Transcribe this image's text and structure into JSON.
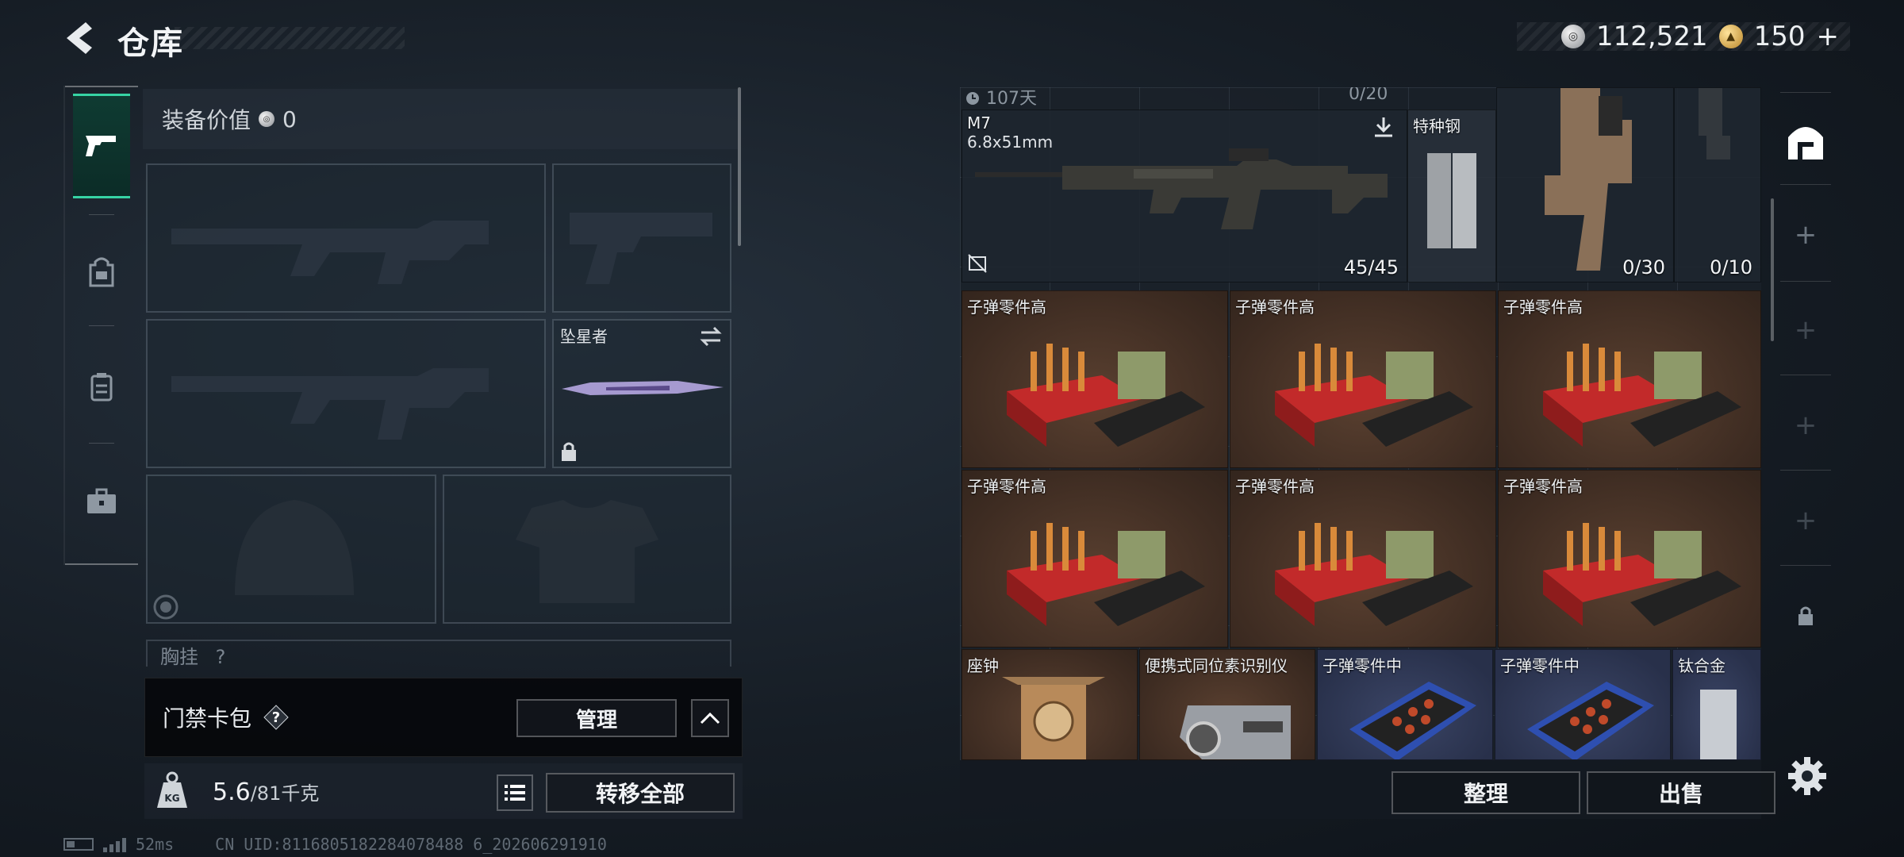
{
  "header": {
    "title": "仓库",
    "currency_silver": "112,521",
    "currency_gold": "150",
    "currency_gold_add": "+"
  },
  "side_nav": {
    "items": [
      "weapon",
      "backpack",
      "vest",
      "case"
    ]
  },
  "equipment": {
    "value_label": "装备价值",
    "value": "0",
    "melee_name": "坠星者",
    "chest_label": "胸挂",
    "chest_help": "?"
  },
  "keycard": {
    "label": "门禁卡包",
    "help": "?",
    "manage": "管理"
  },
  "weight": {
    "current": "5.6",
    "max": "/81千克",
    "transfer": "转移全部"
  },
  "footer": {
    "ping": "52ms",
    "uid": "CN UID:8116805182284078488 6_202606291910"
  },
  "storage": {
    "top_left_faded": "107天",
    "top_right_faded": "0/20",
    "items": [
      {
        "name": "M7",
        "sub": "6.8x51mm",
        "count": "45/45"
      },
      {
        "name": "特种钢",
        "count": ""
      },
      {
        "name": "",
        "count": "0/30"
      },
      {
        "name": "",
        "count": "0/10"
      },
      {
        "name": "子弹零件高"
      },
      {
        "name": "子弹零件高"
      },
      {
        "name": "子弹零件高"
      },
      {
        "name": "子弹零件高"
      },
      {
        "name": "子弹零件高"
      },
      {
        "name": "子弹零件高"
      },
      {
        "name": "座钟"
      },
      {
        "name": "便携式同位素识别仪"
      },
      {
        "name": "子弹零件中"
      },
      {
        "name": "子弹零件中"
      },
      {
        "name": "钛合金"
      }
    ],
    "sort": "整理",
    "sell": "出售"
  },
  "right_tabs": {
    "plus": "+"
  },
  "colors": {
    "accent": "#36d3a4",
    "item_brown": "#3e2c22",
    "item_navy": "#28304a"
  }
}
